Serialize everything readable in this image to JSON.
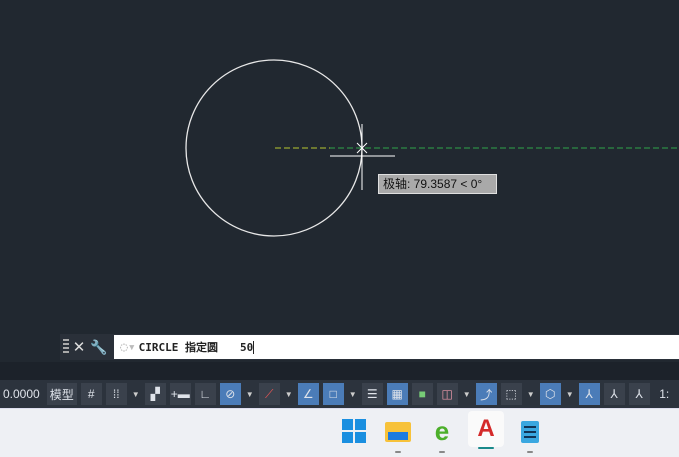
{
  "tooltip": {
    "label": "极轴: 79.3587 < 0°"
  },
  "command": {
    "close": "✕",
    "settings": "🔧",
    "prompt": "CIRCLE 指定圆",
    "value": "50"
  },
  "status": {
    "coords": "0.0000",
    "model": "模型",
    "scale": "1:"
  },
  "taskbar": {
    "apps": [
      "start",
      "file-explorer",
      "internet-explorer",
      "autocad",
      "notepad"
    ]
  },
  "colors": {
    "canvas": "#212830",
    "accent": "#4b7cb8"
  }
}
